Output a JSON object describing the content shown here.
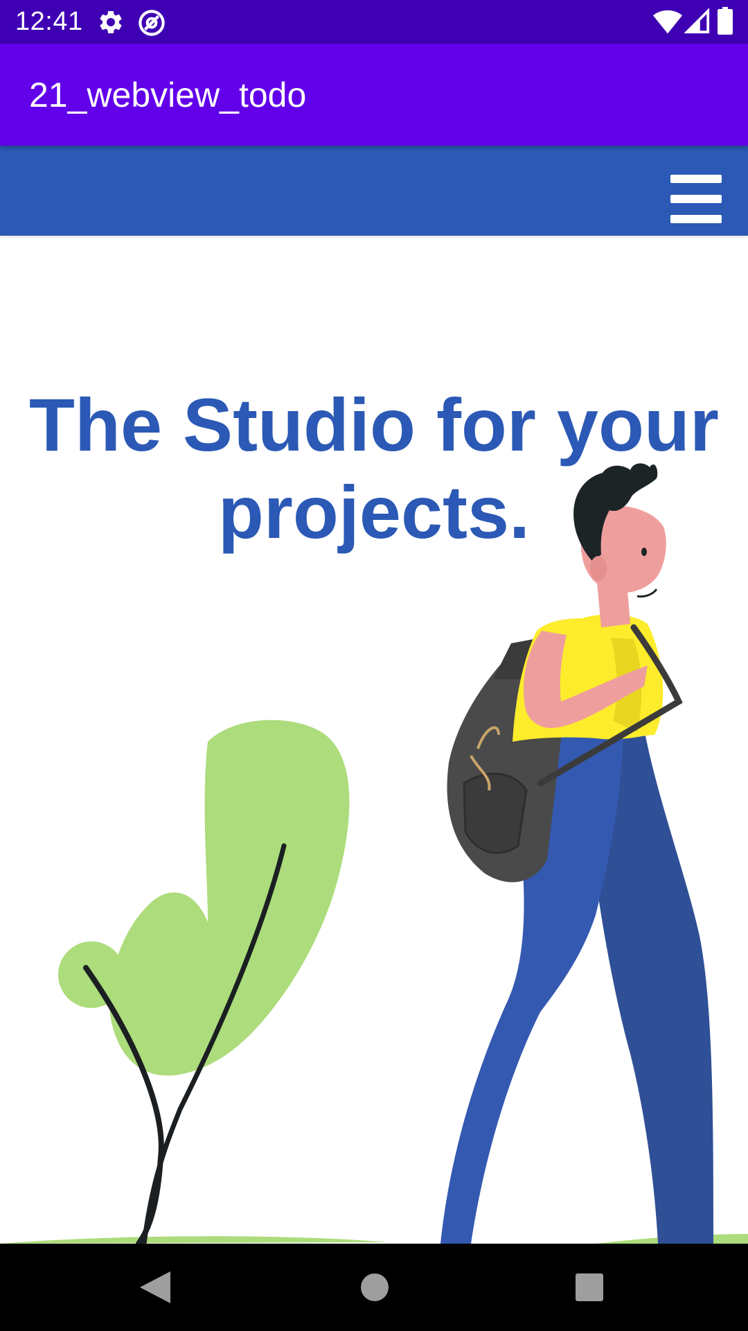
{
  "status_bar": {
    "time": "12:41",
    "left_icons": [
      "settings-gear-icon",
      "at-sign-icon"
    ],
    "right_icons": [
      "wifi-icon",
      "signal-icon",
      "battery-icon"
    ],
    "background": "#3f00b4"
  },
  "app_bar": {
    "title": "21_webview_todo",
    "background": "#6200ea"
  },
  "web_nav": {
    "background": "#2b59b5",
    "menu_icon": "hamburger-menu-icon"
  },
  "hero": {
    "heading": "The Studio for your projects.",
    "color": "#2b59b5"
  },
  "illustration": {
    "description_icons": [
      "walking-student-illustration",
      "plant-illustration"
    ]
  },
  "nav_bar": {
    "buttons": [
      "back-icon",
      "home-icon",
      "recents-icon"
    ]
  }
}
